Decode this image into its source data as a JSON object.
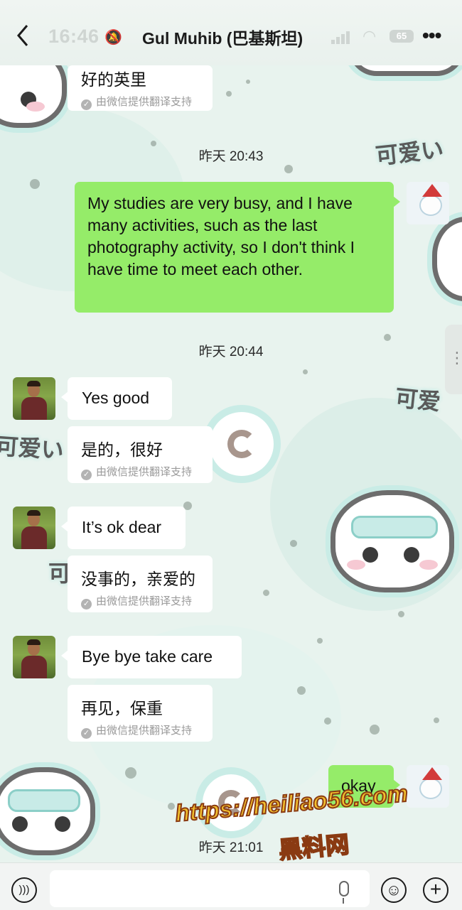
{
  "status_bar": {
    "time": "16:46",
    "battery": "65"
  },
  "header": {
    "title": "Gul Muhib (巴基斯坦)"
  },
  "messages": {
    "m0": {
      "translation": "好的英里",
      "note": "由微信提供翻译支持"
    },
    "ts1": "昨天 20:43",
    "m1": {
      "text": "My studies are very busy, and I have many activities, such as the last photography activity, so I don't think I have time to meet each other."
    },
    "ts2": "昨天 20:44",
    "m2": {
      "text": "Yes good",
      "translation": "是的，很好",
      "note": "由微信提供翻译支持"
    },
    "m3": {
      "text": "It’s ok dear",
      "translation": "没事的，亲爱的",
      "note": "由微信提供翻译支持"
    },
    "m4": {
      "text": "Bye bye take care",
      "translation": "再见，保重",
      "note": "由微信提供翻译支持"
    },
    "m5": {
      "text": "okay"
    },
    "ts3": "昨天 21:01"
  },
  "wallpaper": {
    "text1": "可爱い",
    "text2": "可爱",
    "text3": "可爱い",
    "text4": "可"
  },
  "watermark": {
    "url": "https://heiliao56.com",
    "name": "黑料网"
  },
  "colors": {
    "out_bubble": "#95ec69",
    "in_bubble": "#ffffff",
    "background": "#e8f3ee"
  },
  "icons": [
    "back-arrow-icon",
    "mute-bell-icon",
    "signal-icon",
    "wifi-icon",
    "battery-icon",
    "more-icon",
    "check-icon",
    "voice-icon",
    "mic-icon",
    "emoji-icon",
    "plus-icon"
  ]
}
